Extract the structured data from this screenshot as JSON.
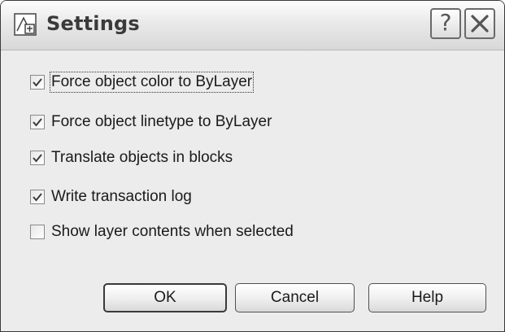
{
  "window": {
    "title": "Settings",
    "help_button": "?",
    "close_icon": "close-icon"
  },
  "options": [
    {
      "label": "Force object color to ByLayer",
      "checked": true
    },
    {
      "label": "Force object linetype to ByLayer",
      "checked": true
    },
    {
      "label": "Translate objects in blocks",
      "checked": true
    },
    {
      "label": "Write transaction log",
      "checked": true
    },
    {
      "label": "Show layer contents when selected",
      "checked": false
    }
  ],
  "buttons": {
    "ok": "OK",
    "cancel": "Cancel",
    "help": "Help"
  },
  "colors": {
    "dialog_bg": "#ececec",
    "check_mark": "#3a3a3a"
  }
}
